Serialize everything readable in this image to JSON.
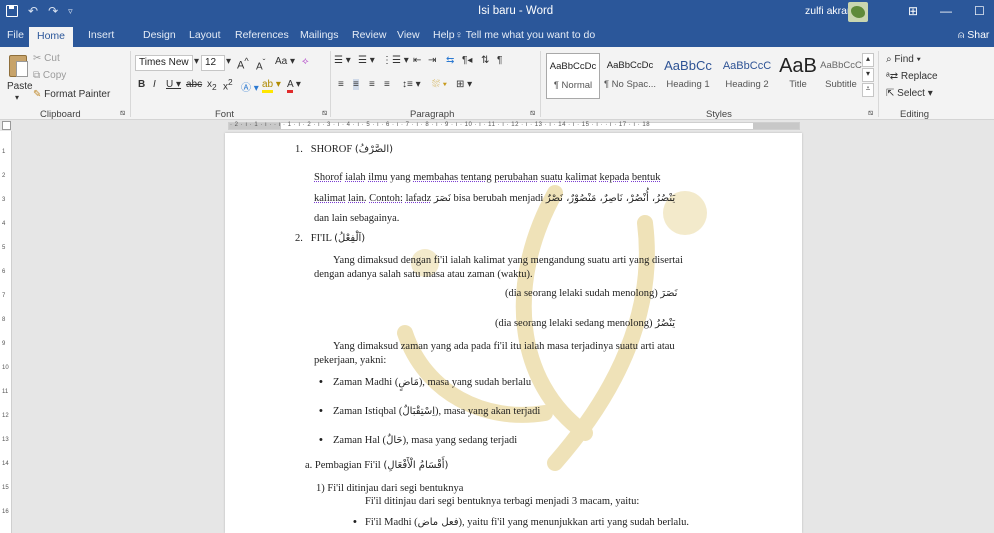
{
  "titlebar": {
    "title": "Isi baru - Word",
    "user": "zulfi akram",
    "min": "—",
    "max": "☐",
    "ribbon_opts": "⊞"
  },
  "tabs": [
    "File",
    "Home",
    "Insert",
    "Design",
    "Layout",
    "References",
    "Mailings",
    "Review",
    "View",
    "Help"
  ],
  "tell_me": "Tell me what you want to do",
  "share": "Shar",
  "ribbon": {
    "clipboard": {
      "paste": "Paste",
      "cut": "Cut",
      "copy": "Copy",
      "format_painter": "Format Painter",
      "label": "Clipboard"
    },
    "font": {
      "family": "Times New F",
      "size": "12",
      "label": "Font"
    },
    "paragraph": {
      "label": "Paragraph"
    },
    "styles": {
      "label": "Styles",
      "items": [
        {
          "preview": "AaBbCcDc",
          "name": "¶ Normal"
        },
        {
          "preview": "AaBbCcDc",
          "name": "¶ No Spac..."
        },
        {
          "preview": "AaBbCc",
          "name": "Heading 1"
        },
        {
          "preview": "AaBbCcC",
          "name": "Heading 2"
        },
        {
          "preview": "AaB",
          "name": "Title"
        },
        {
          "preview": "AaBbCcC",
          "name": "Subtitle"
        }
      ]
    },
    "editing": {
      "find": "Find",
      "replace": "Replace",
      "select": "Select",
      "label": "Editing"
    }
  },
  "ruler": {
    "ticks": "· 2 · ı · 1 · ı ·   · ı · 1 · ı · 2 · ı · 3 · ı · 4 · ı · 5 · ı · 6 · ı · 7 · ı · 8 · ı · 9 · ı · 10 · ı · 11 · ı · 12 · ı · 13 · ı · 14 · ı · 15 · ı ·   · ı · 17 · ı · 18"
  },
  "vruler": [
    "1",
    "2",
    "3",
    "4",
    "5",
    "6",
    "7",
    "8",
    "9",
    "10",
    "11",
    "12",
    "13",
    "14",
    "15",
    "16"
  ],
  "doc": {
    "h1_num": "1.",
    "h1_text": "SHOROF",
    "h1_arab": "(الصَّرْفُ)",
    "p1_parts": [
      "Shorof",
      "ialah",
      "ilmu",
      "yang",
      "membahas",
      "tentang",
      "perubahan",
      "suatu",
      "kalimat",
      "kepada",
      "bentuk"
    ],
    "p1_line2_a": "kalimat",
    "p1_line2_b": "lain.",
    "p1_line2_c": "Contoh:",
    "p1_line2_d": "lafadz",
    "p1_arab1": "نَصَرَ",
    "p1_line2_e": "bisa berubah menjadi",
    "p1_arab2": "يَنْصُرُ، أُنْصُرْ، نَاصِرٌ، مَنْصُوْرٌ، نَصْرٌ",
    "p1_line3": "dan lain sebagainya.",
    "h2_num": "2.",
    "h2_text": "FI'IL",
    "h2_arab": "(اَلْفِعْلُ)",
    "p2_line1": "Yang dimaksud dengan fi'il ialah kalimat yang mengandung suatu arti yang disertai",
    "p2_line2": "dengan adanya salah satu masa atau zaman (waktu).",
    "ex1_text": "(dia seorang lelaki sudah menolong)",
    "ex1_arab": "نَصَرَ",
    "ex2_text": "(dia seorang lelaki sedang menolong)",
    "ex2_arab": "يَنْصُرُ",
    "p3_line1": "Yang dimaksud zaman yang ada pada fi'il itu ialah masa terjadinya suatu arti atau",
    "p3_line2": "pekerjaan, yakni:",
    "b1_a": "Zaman Madhi (",
    "b1_arab": "مَاضٍ",
    "b1_b": "), masa yang sudah berlalu",
    "b2_a": "Zaman Istiqbal (",
    "b2_arab": "اِسْتِقْبَالٌ",
    "b2_b": "), masa yang akan terjadi",
    "b3_a": "Zaman Hal (",
    "b3_arab": "حَالٌ",
    "b3_b": "), masa yang sedang terjadi",
    "sub_a": "a. Pembagian Fi'il",
    "sub_a_arab": "(أَقْسَامُ الْأَفْعَالِ)",
    "sub_1": "1)  Fi'il ditinjau dari segi bentuknya",
    "sub_1_line": "Fi'il ditinjau dari segi bentuknya terbagi menjadi 3 macam, yaitu:",
    "sub_b1_a": "Fi'il Madhi (",
    "sub_b1_arab": "فعل ماض",
    "sub_b1_b": "), yaitu fi'il yang menunjukkan arti yang sudah berlalu."
  }
}
